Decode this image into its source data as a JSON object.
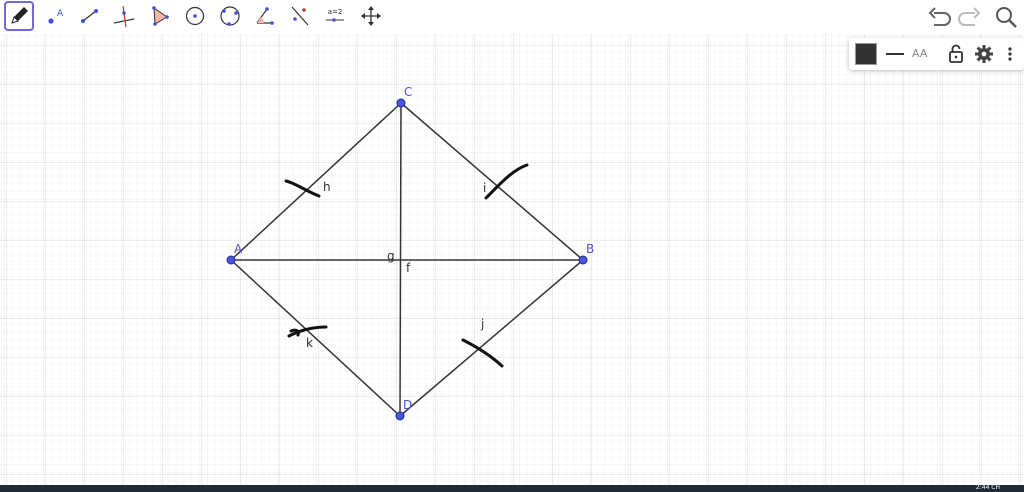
{
  "toolbar": {
    "tools": [
      {
        "id": "pen",
        "icon": "pencil-icon",
        "active": true
      },
      {
        "id": "point",
        "icon": "point-icon",
        "label": "A"
      },
      {
        "id": "segment",
        "icon": "segment-icon"
      },
      {
        "id": "perpendicular",
        "icon": "perpendicular-line-icon"
      },
      {
        "id": "polygon",
        "icon": "polygon-icon"
      },
      {
        "id": "circle-center",
        "icon": "circle-center-point-icon"
      },
      {
        "id": "circle-three-points",
        "icon": "circle-three-points-icon"
      },
      {
        "id": "angle",
        "icon": "angle-icon"
      },
      {
        "id": "reflect",
        "icon": "reflect-line-icon"
      },
      {
        "id": "slider",
        "icon": "slider-icon",
        "label": "a=2"
      },
      {
        "id": "move-view",
        "icon": "move-graphics-view-icon"
      }
    ]
  },
  "header": {
    "undo_icon": "undo-icon",
    "redo_icon": "redo-icon",
    "search_icon": "search-icon"
  },
  "style_bar": {
    "color_swatch": "#333333",
    "line_style_icon": "line-style-icon",
    "text_style_label": "AA",
    "lock_icon": "lock-icon",
    "settings_icon": "gear-icon",
    "more_icon": "more-vertical-icon"
  },
  "geometry": {
    "points": [
      {
        "name": "A",
        "label": "A"
      },
      {
        "name": "B",
        "label": "B"
      },
      {
        "name": "C",
        "label": "C"
      },
      {
        "name": "D",
        "label": "D"
      }
    ],
    "segment_labels": {
      "h": "h",
      "i": "i",
      "j": "j",
      "k": "k",
      "f": "f",
      "g": "g"
    },
    "point_color": "#4a56d6",
    "line_color": "#333333"
  },
  "taskbar": {
    "time": "2:44 CH"
  }
}
